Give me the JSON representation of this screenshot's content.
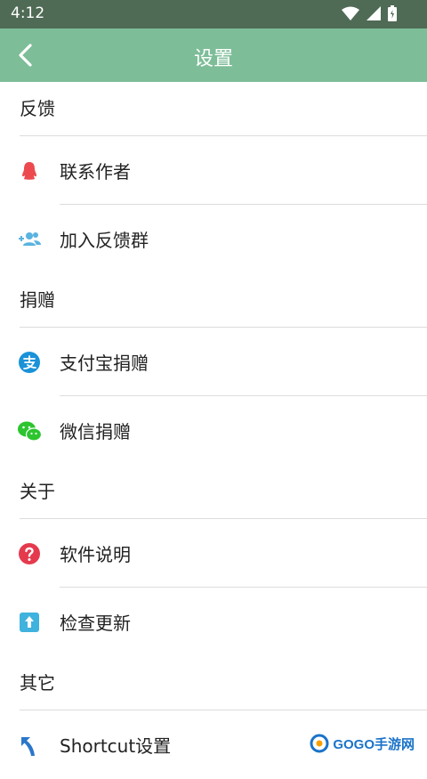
{
  "status_bar": {
    "time": "4:12"
  },
  "app_bar": {
    "title": "设置"
  },
  "sections": [
    {
      "header": "反馈",
      "items": [
        {
          "label": "联系作者",
          "icon": "qq-penguin-icon"
        },
        {
          "label": "加入反馈群",
          "icon": "add-group-icon"
        }
      ]
    },
    {
      "header": "捐赠",
      "items": [
        {
          "label": "支付宝捐赠",
          "icon": "alipay-icon"
        },
        {
          "label": "微信捐赠",
          "icon": "wechat-icon"
        }
      ]
    },
    {
      "header": "关于",
      "items": [
        {
          "label": "软件说明",
          "icon": "help-icon"
        },
        {
          "label": "检查更新",
          "icon": "update-icon"
        }
      ]
    },
    {
      "header": "其它",
      "items": [
        {
          "label": "Shortcut设置",
          "icon": "shortcut-arrow-icon"
        }
      ]
    }
  ],
  "watermark": {
    "text": "GOGO手游网"
  },
  "colors": {
    "app_bar": "#7dbd98",
    "status_bar": "#4f6a55",
    "divider": "#dcdcdc"
  }
}
